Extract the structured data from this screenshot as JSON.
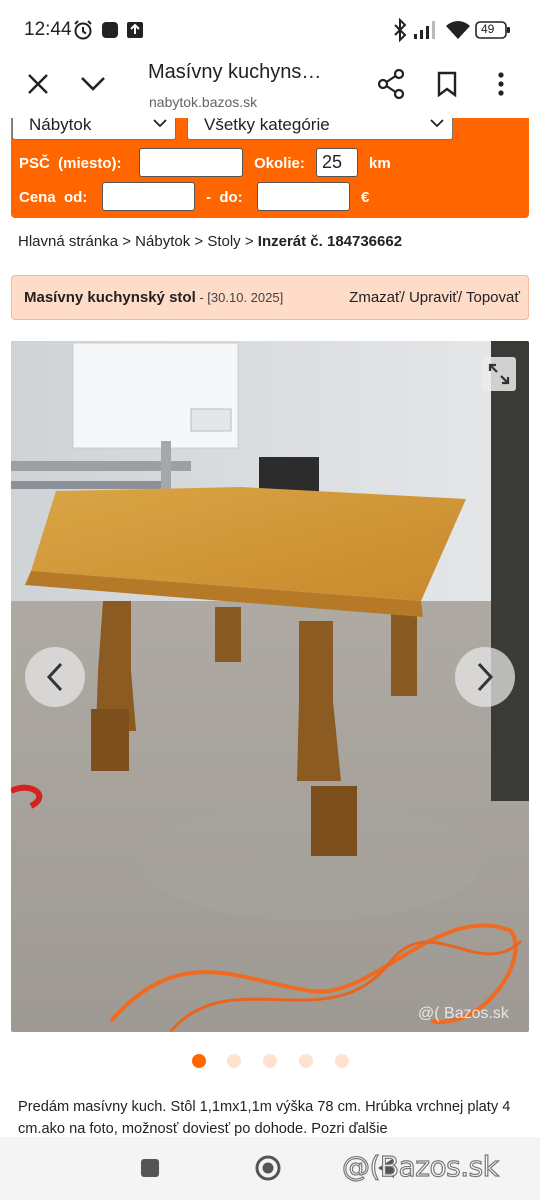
{
  "status_bar": {
    "time": "12:44",
    "battery": "49",
    "icons": [
      "alarm-icon",
      "app-square-icon",
      "upload-icon",
      "bluetooth-icon",
      "signal-icon",
      "wifi-icon",
      "battery-icon"
    ]
  },
  "browser": {
    "title": "Masívny kuchyns…",
    "url": "nabytok.bazos.sk",
    "icons": [
      "close-icon",
      "chevron-down-icon",
      "share-icon",
      "bookmark-icon",
      "more-vert-icon"
    ]
  },
  "search": {
    "category_select": "Nábytok",
    "subcategory_select": "Všetky kategórie",
    "psc_label": "PSČ  (miesto):",
    "psc_value": "",
    "okolie_label": "Okolie:",
    "okolie_value": "25",
    "km_label": "km",
    "cena_label": "Cena  od:",
    "cena_od_value": "",
    "dash_do_label": "-  do:",
    "cena_do_value": "",
    "currency_label": "€",
    "accent_color": "#ff6600"
  },
  "breadcrumb": {
    "home": "Hlavná stránka",
    "sep1": " > ",
    "category": "Nábytok",
    "sep2": " > ",
    "subcategory": "Stoly",
    "sep3": " > ",
    "current": "Inzerát č. 184736662"
  },
  "listing": {
    "title": "Masívny kuchynský stol",
    "date": " - [30.10. 2025]",
    "actions": "Zmazať/ Upraviť/ Topovať"
  },
  "gallery": {
    "watermark": "@( Bazos.sk",
    "dot_count": 5,
    "active_dot": 0,
    "icons": [
      "expand-icon",
      "chevron-left-icon",
      "chevron-right-icon"
    ]
  },
  "description": {
    "text": "Predám masívny kuch. Stôl 1,1mx1,1m výška 78 cm. Hrúbka vrchnej platy 4 cm.ako na foto, možnosť doviesť po dohode. Pozri ďalšie"
  },
  "bottom_nav": {
    "brand": "@(Bazos.sk",
    "icons": [
      "recents-square-icon",
      "home-circle-icon",
      "back-triangle-icon"
    ]
  }
}
